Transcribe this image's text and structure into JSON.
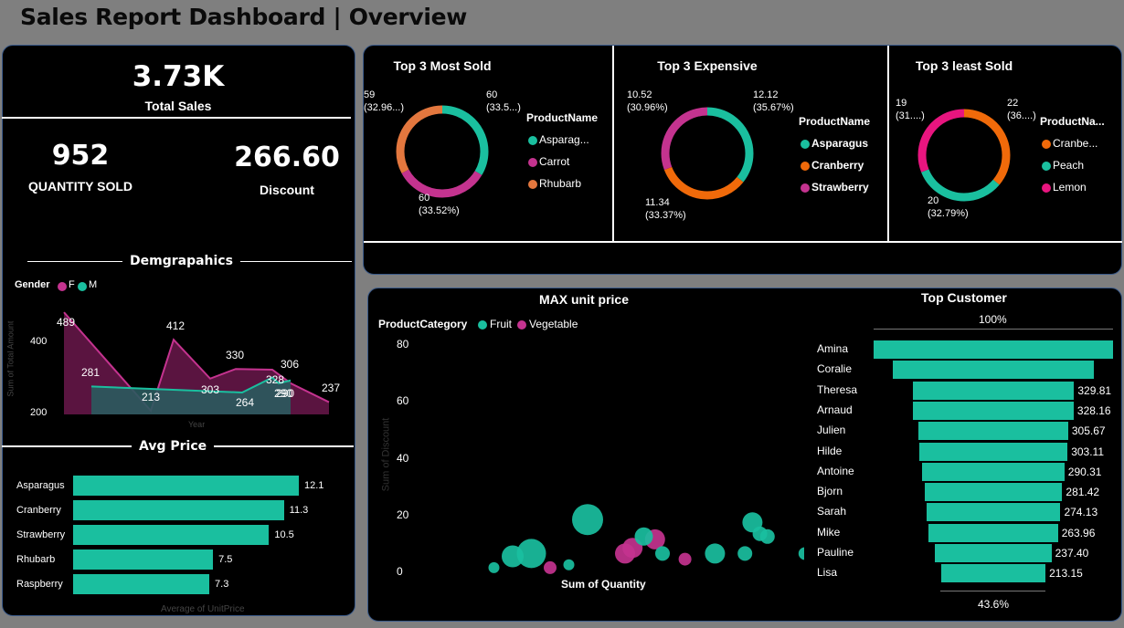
{
  "title": "Sales Report  Dashboard | Overview",
  "kpis": {
    "total_sales": "3.73K",
    "total_sales_label": "Total Sales",
    "quantity": "952",
    "quantity_label": "QUANTITY SOLD",
    "discount": "266.60",
    "discount_label": "Discount"
  },
  "colors": {
    "teal": "#1abf9f",
    "magenta": "#c4338f",
    "orange": "#f06a0a",
    "pink": "#e8157f",
    "coral": "#e3773e"
  },
  "donuts": [
    {
      "title": "Top 3 Most Sold",
      "legend_title": "ProductName",
      "items": [
        "Asparag...",
        "Carrot",
        "Rhubarb"
      ],
      "colors": [
        "#1abf9f",
        "#c4338f",
        "#e3773e"
      ],
      "values": [
        60,
        60,
        59
      ],
      "labels": [
        {
          "v": "60",
          "p": "(33.5...)"
        },
        {
          "v": "60",
          "p": "(33.52%)"
        },
        {
          "v": "59",
          "p": "(32.96...)"
        }
      ]
    },
    {
      "title": "Top 3 Expensive",
      "legend_title": "ProductName",
      "items": [
        "Asparagus",
        "Cranberry",
        "Strawberry"
      ],
      "colors": [
        "#1abf9f",
        "#f06a0a",
        "#c4338f"
      ],
      "values": [
        12.12,
        11.34,
        10.52
      ],
      "labels": [
        {
          "v": "12.12",
          "p": "(35.67%)"
        },
        {
          "v": "11.34",
          "p": "(33.37%)"
        },
        {
          "v": "10.52",
          "p": "(30.96%)"
        }
      ]
    },
    {
      "title": "Top 3 least Sold",
      "legend_title": "ProductNa...",
      "items": [
        "Cranbe...",
        "Peach",
        "Lemon"
      ],
      "colors": [
        "#f06a0a",
        "#1abf9f",
        "#e8157f"
      ],
      "values": [
        22,
        20,
        19
      ],
      "labels": [
        {
          "v": "22",
          "p": "(36....)"
        },
        {
          "v": "20",
          "p": "(32.79%)"
        },
        {
          "v": "19",
          "p": "(31....)"
        }
      ]
    }
  ],
  "demographics": {
    "title": "Demgrapahics",
    "legend_title": "Gender",
    "legend": [
      "F",
      "M"
    ],
    "ylabel": "Sum of Total Amount",
    "xlabel": "Year",
    "yticks": [
      "400",
      "200"
    ],
    "chart_data": {
      "type": "area",
      "ylim": [
        200,
        520
      ],
      "series": [
        {
          "name": "F",
          "values": [
            489,
            213,
            412,
            303,
            330,
            328,
            290,
            237
          ],
          "labels": [
            "489",
            "213",
            "412",
            "303",
            "330",
            "328",
            "290",
            "237"
          ]
        },
        {
          "name": "M",
          "values": [
            281,
            null,
            null,
            264,
            306,
            290
          ],
          "labels": [
            "281",
            "264",
            "306",
            "290"
          ]
        }
      ]
    }
  },
  "avg_price": {
    "title": "Avg Price",
    "xlabel": "Average of UnitPrice",
    "chart_data": {
      "type": "bar",
      "categories": [
        "Asparagus",
        "Cranberry",
        "Strawberry",
        "Rhubarb",
        "Raspberry"
      ],
      "values": [
        12.1,
        11.3,
        10.5,
        7.5,
        7.3
      ],
      "labels": [
        "12.1",
        "11.3",
        "10.5",
        "7.5",
        "7.3"
      ]
    }
  },
  "scatter": {
    "title": "MAX unit price",
    "legend_title": "ProductCategory",
    "legend": [
      "Fruit",
      "Vegetable"
    ],
    "xlabel": "Sum of Quantity",
    "ylabel": "Sum of Discount",
    "yticks": [
      "80",
      "60",
      "40",
      "20",
      "0"
    ],
    "chart_data": {
      "type": "scatter",
      "ylim": [
        0,
        80
      ],
      "points": [
        {
          "x": 5,
          "y": 1,
          "s": 6,
          "c": "Fruit"
        },
        {
          "x": 10,
          "y": 5,
          "s": 12,
          "c": "Fruit"
        },
        {
          "x": 15,
          "y": 6,
          "s": 16,
          "c": "Fruit"
        },
        {
          "x": 20,
          "y": 1,
          "s": 7,
          "c": "Vegetable"
        },
        {
          "x": 25,
          "y": 2,
          "s": 6,
          "c": "Fruit"
        },
        {
          "x": 30,
          "y": 18,
          "s": 17,
          "c": "Fruit"
        },
        {
          "x": 42,
          "y": 8,
          "s": 11,
          "c": "Vegetable"
        },
        {
          "x": 40,
          "y": 6,
          "s": 11,
          "c": "Vegetable"
        },
        {
          "x": 48,
          "y": 11,
          "s": 11,
          "c": "Vegetable"
        },
        {
          "x": 45,
          "y": 12,
          "s": 10,
          "c": "Fruit"
        },
        {
          "x": 50,
          "y": 6,
          "s": 8,
          "c": "Fruit"
        },
        {
          "x": 56,
          "y": 4,
          "s": 7,
          "c": "Vegetable"
        },
        {
          "x": 64,
          "y": 6,
          "s": 11,
          "c": "Fruit"
        },
        {
          "x": 72,
          "y": 6,
          "s": 8,
          "c": "Fruit"
        },
        {
          "x": 74,
          "y": 17,
          "s": 11,
          "c": "Fruit"
        },
        {
          "x": 76,
          "y": 13,
          "s": 8,
          "c": "Fruit"
        },
        {
          "x": 78,
          "y": 12,
          "s": 8,
          "c": "Fruit"
        },
        {
          "x": 88,
          "y": 6,
          "s": 7,
          "c": "Fruit"
        },
        {
          "x": 90,
          "y": 4,
          "s": 6,
          "c": "Vegetable"
        },
        {
          "x": 100,
          "y": 22,
          "s": 11,
          "c": "Vegetable"
        },
        {
          "x": 100,
          "y": 76,
          "s": 11,
          "c": "Vegetable"
        },
        {
          "x": 101,
          "y": 6,
          "s": 6,
          "c": "Vegetable"
        }
      ]
    }
  },
  "top_customer": {
    "title": "Top Customer",
    "top_pct": "100%",
    "bottom_pct": "43.6%",
    "chart_data": {
      "type": "bar",
      "categories": [
        "Amina",
        "Coralie",
        "Theresa",
        "Arnaud",
        "Julien",
        "Hilde",
        "Antoine",
        "Bjorn",
        "Sarah",
        "Mike",
        "Pauline",
        "Lisa"
      ],
      "values": [
        489,
        412,
        329.81,
        328.16,
        305.67,
        303.11,
        290.31,
        281.42,
        274.13,
        263.96,
        237.4,
        213.15
      ],
      "labels": [
        "",
        "",
        "329.81",
        "328.16",
        "305.67",
        "303.11",
        "290.31",
        "281.42",
        "274.13",
        "263.96",
        "237.40",
        "213.15"
      ]
    }
  }
}
